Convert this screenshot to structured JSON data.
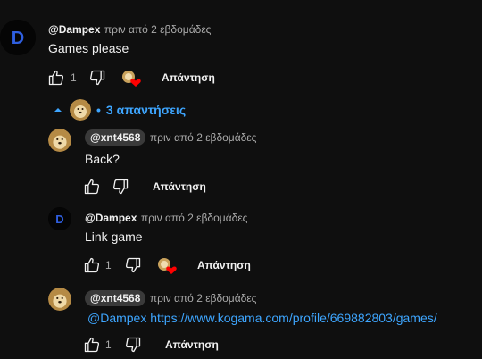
{
  "comment": {
    "author": "@Dampex",
    "time": "πριν από 2 εβδομάδες",
    "text": "Games please",
    "likes": "1",
    "reply_label": "Απάντηση",
    "avatar_letter": "D"
  },
  "replies_toggle": {
    "label": "3 απαντήσεις",
    "separator": "•"
  },
  "replies": [
    {
      "author": "@xnt4568",
      "time": "πριν από 2 εβδομάδες",
      "text": "Back?",
      "likes": "",
      "reply_label": "Απάντηση"
    },
    {
      "author": "@Dampex",
      "time": "πριν από 2 εβδομάδες",
      "text": "Link game",
      "likes": "1",
      "reply_label": "Απάντηση",
      "avatar_letter": "D"
    },
    {
      "author": "@xnt4568",
      "time": "πριν από 2 εβδομάδες",
      "mention": "@Dampex",
      "link": "https://www.kogama.com/profile/669882803/games/",
      "likes": "1",
      "reply_label": "Απάντηση"
    }
  ],
  "colors": {
    "background": "#0f0f0f",
    "link": "#3ea6ff",
    "heart": "#ff0000",
    "avatar_d": "#2f5fe0"
  },
  "icons": [
    "thumb-up-icon",
    "thumb-down-icon",
    "creator-heart-icon",
    "caret-up-icon",
    "dog-avatar-icon",
    "d-logo-avatar-icon"
  ]
}
